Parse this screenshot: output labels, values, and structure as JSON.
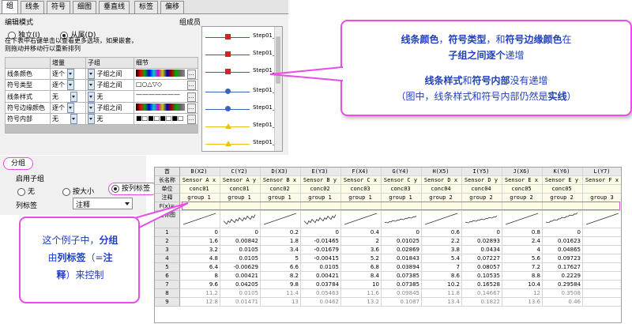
{
  "tabs": [
    "组",
    "线条",
    "符号",
    "细图",
    "垂直线",
    "标签",
    "偏移"
  ],
  "edit_mode": {
    "title": "编辑模式",
    "opt_independent": "独立(I)",
    "opt_dependent": "从属(D)"
  },
  "hint": "在下表中右键单击以查看更多选项，如果嵌套，则拖动并移动行以重新排列",
  "detail_table": {
    "headers": [
      "",
      "增量",
      "子组",
      "细节"
    ],
    "rows": [
      {
        "name": "线条颜色",
        "inc": "逐个",
        "sub": "子组之间",
        "detail": "rainbow"
      },
      {
        "name": "符号类型",
        "inc": "逐个",
        "sub": "子组之间",
        "detail": "□○△▽◇"
      },
      {
        "name": "线条样式",
        "inc": "无",
        "sub": "无",
        "detail": "———————"
      },
      {
        "name": "符号边缘颜色",
        "inc": "逐个",
        "sub": "子组之间",
        "detail": "rainbow"
      },
      {
        "name": "符号内部",
        "inc": "无",
        "sub": "无",
        "detail": "■□■□■□■□"
      }
    ]
  },
  "group_members": {
    "title": "组成员",
    "items": [
      {
        "label": "Step01_",
        "color": "#e02020",
        "marker": "square"
      },
      {
        "label": "Step01_",
        "color": "#e02020",
        "marker": "square"
      },
      {
        "label": "Step01_",
        "color": "#e02020",
        "marker": "square"
      },
      {
        "label": "Step01_",
        "color": "#3a67b5",
        "marker": "circle"
      },
      {
        "label": "Step01_",
        "color": "#3a67b5",
        "marker": "circle"
      },
      {
        "label": "Step01_",
        "color": "#e8c21a",
        "marker": "triangle"
      },
      {
        "label": "Step01_",
        "color": "#e8c21a",
        "marker": "triangle"
      }
    ]
  },
  "grouping": {
    "title": "分组",
    "subgroup_label": "启用子组",
    "opt_none": "无",
    "opt_size": "按大小",
    "opt_col_label": "按列标签",
    "col_label_title": "列标签",
    "col_label_value": "注释"
  },
  "callout_top": {
    "line1_a": "线条颜色",
    "line1_b": "，",
    "line1_c": "符号类型",
    "line1_d": "，和",
    "line1_e": "符号边缘颜色",
    "line1_f": "在",
    "line2_a": "子组之间逐个",
    "line2_b": "递增",
    "line3_a": "线条样式",
    "line3_b": "和",
    "line3_c": "符号内部",
    "line3_d": "没有递增",
    "line4_a": "（图中，线条样式和符号内部仍然是",
    "line4_b": "实线",
    "line4_c": "）"
  },
  "callout_bottom": {
    "t1": "这个例子中，",
    "t2": "分组",
    "t3": "由",
    "t4": "列标签",
    "t5": "（=",
    "t6": "注",
    "t7": "释",
    "t8": "）来控制"
  },
  "sheet": {
    "corner": "首",
    "col_heads": [
      "B(X2)",
      "C(Y2)",
      "D(X3)",
      "E(Y3)",
      "F(X4)",
      "G(Y4)",
      "H(X5)",
      "I(Y5)",
      "J(X6)",
      "K(Y6)",
      "L(Y7)"
    ],
    "row_labels": [
      "长名称",
      "单位",
      "注释",
      "F(x)=",
      "迷你图"
    ],
    "long_names": [
      "Sensor A x",
      "Sensor A y",
      "Sensor B x",
      "Sensor B y",
      "Sensor C x",
      "Sensor C y",
      "Sensor D x",
      "Sensor D y",
      "Sensor E x",
      "Sensor E y",
      "Sensor F x"
    ],
    "units": [
      "conc01",
      "conc01",
      "conc02",
      "conc02",
      "conc03",
      "conc03",
      "conc04",
      "conc04",
      "conc05",
      "conc05",
      ""
    ],
    "comments": [
      "group 1",
      "group 1",
      "group 1",
      "group 1",
      "group 1",
      "group 1",
      "group 2",
      "group 2",
      "group 2",
      "group 2",
      "group 3"
    ],
    "data_rows": [
      {
        "n": "1",
        "v": [
          "0",
          "0",
          "0.2",
          "0",
          "0.4",
          "0",
          "0.6",
          "0",
          "0.8",
          "0",
          ""
        ]
      },
      {
        "n": "2",
        "v": [
          "1.6",
          "0.00842",
          "1.8",
          "-0.01465",
          "2",
          "0.01025",
          "2.2",
          "0.02893",
          "2.4",
          "0.01623",
          ""
        ]
      },
      {
        "n": "3",
        "v": [
          "3.2",
          "0.0105",
          "3.4",
          "-0.01679",
          "3.6",
          "0.02869",
          "3.8",
          "0.0434",
          "4",
          "0.04865",
          ""
        ]
      },
      {
        "n": "4",
        "v": [
          "4.8",
          "0.0105",
          "5",
          "-0.00415",
          "5.2",
          "0.01843",
          "5.4",
          "0.07227",
          "5.6",
          "0.09723",
          ""
        ]
      },
      {
        "n": "5",
        "v": [
          "6.4",
          "-0.00629",
          "6.6",
          "0.0105",
          "6.8",
          "0.03894",
          "7",
          "0.08057",
          "7.2",
          "0.17627",
          ""
        ]
      },
      {
        "n": "6",
        "v": [
          "8",
          "0.00421",
          "8.2",
          "0.00421",
          "8.4",
          "0.07385",
          "8.6",
          "0.10535",
          "8.8",
          "0.2229",
          ""
        ]
      },
      {
        "n": "7",
        "v": [
          "9.6",
          "0.04205",
          "9.8",
          "0.03784",
          "10",
          "0.07385",
          "10.2",
          "0.16528",
          "10.4",
          "0.29584",
          ""
        ]
      },
      {
        "n": "8",
        "v": [
          "11.2",
          "0.0105",
          "11.4",
          "0.05463",
          "11.6",
          "0.09845",
          "11.8",
          "0.14667",
          "12",
          "0.3508",
          ""
        ]
      },
      {
        "n": "9",
        "v": [
          "12.8",
          "0.01471",
          "13",
          "0.0462",
          "13.2",
          "0.1087",
          "13.4",
          "0.1822",
          "13.6",
          "0.46",
          ""
        ]
      }
    ]
  }
}
